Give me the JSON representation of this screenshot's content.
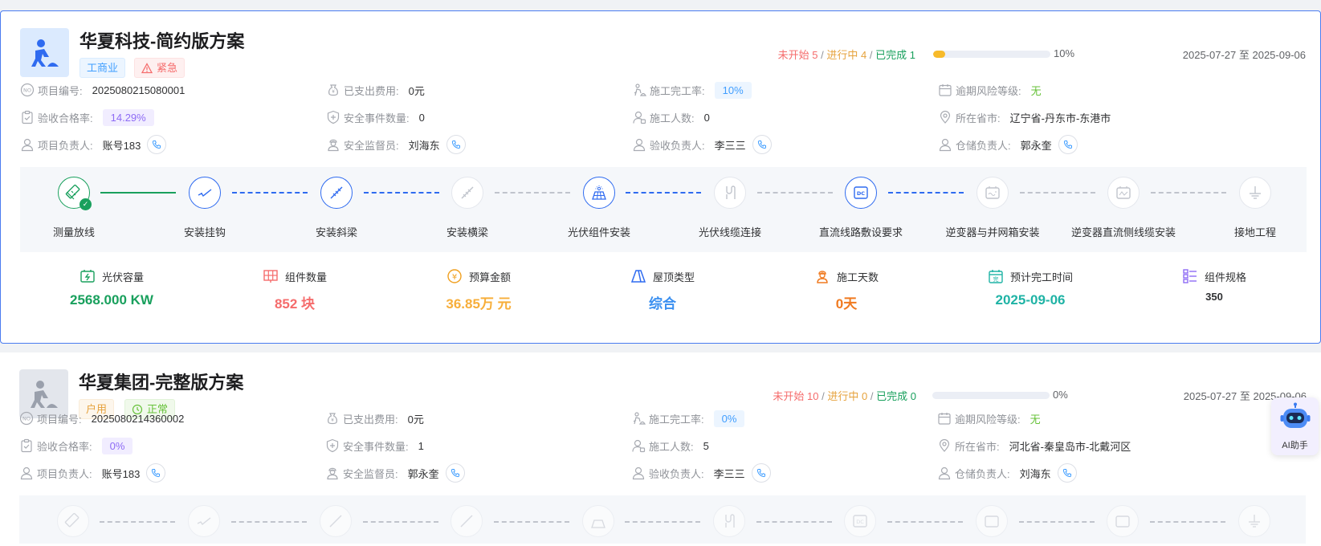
{
  "projects": [
    {
      "title": "华夏科技-简约版方案",
      "type_tag": "工商业",
      "status_tag": "紧急",
      "counts": {
        "not_started_label": "未开始",
        "not_started": "5",
        "in_progress_label": "进行中",
        "in_progress": "4",
        "done_label": "已完成",
        "done": "1",
        "sep": "/"
      },
      "progress_percent": 10,
      "progress_text": "10%",
      "date_range": "2025-07-27 至 2025-09-06",
      "fields": {
        "project_no_label": "项目编号:",
        "project_no": "2025080215080001",
        "spent_label": "已支出费用:",
        "spent": "0元",
        "completion_rate_label": "施工完工率:",
        "completion_rate": "10%",
        "overdue_risk_label": "逾期风险等级:",
        "overdue_risk": "无",
        "acceptance_rate_label": "验收合格率:",
        "acceptance_rate": "14.29%",
        "safety_events_label": "安全事件数量:",
        "safety_events": "0",
        "workers_label": "施工人数:",
        "workers": "0",
        "region_label": "所在省市:",
        "region": "辽宁省-丹东市-东港市",
        "manager_label": "项目负责人:",
        "manager": "账号183",
        "safety_officer_label": "安全监督员:",
        "safety_officer": "刘海东",
        "acceptance_officer_label": "验收负责人:",
        "acceptance_officer": "李三三",
        "storage_officer_label": "仓储负责人:",
        "storage_officer": "郭永奎"
      },
      "steps": [
        {
          "label": "测量放线",
          "state": "done",
          "icon": "measure-icon"
        },
        {
          "label": "安装挂钩",
          "state": "active",
          "icon": "hook-icon"
        },
        {
          "label": "安装斜梁",
          "state": "active",
          "icon": "slant-beam-icon"
        },
        {
          "label": "安装横梁",
          "state": "pending",
          "icon": "cross-beam-icon"
        },
        {
          "label": "光伏组件安装",
          "state": "active",
          "icon": "solar-panel-icon"
        },
        {
          "label": "光伏线缆连接",
          "state": "pending",
          "icon": "cable-icon"
        },
        {
          "label": "直流线路敷设要求",
          "state": "active",
          "icon": "dc-icon"
        },
        {
          "label": "逆变器与并网箱安装",
          "state": "pending",
          "icon": "inverter-icon"
        },
        {
          "label": "逆变器直流侧线缆安装",
          "state": "pending",
          "icon": "inverter-dc-icon"
        },
        {
          "label": "接地工程",
          "state": "pending",
          "icon": "ground-icon"
        }
      ],
      "metrics": {
        "capacity_label": "光伏容量",
        "capacity": "2568.000 KW",
        "modules_label": "组件数量",
        "modules": "852 块",
        "budget_label": "预算金额",
        "budget": "36.85万 元",
        "roof_label": "屋顶类型",
        "roof": "综合",
        "days_label": "施工天数",
        "days": "0天",
        "finish_label": "预计完工时间",
        "finish": "2025-09-06",
        "spec_label": "组件规格",
        "spec": "350"
      }
    },
    {
      "title": "华夏集团-完整版方案",
      "type_tag": "户用",
      "status_tag": "正常",
      "counts": {
        "not_started_label": "未开始",
        "not_started": "10",
        "in_progress_label": "进行中",
        "in_progress": "0",
        "done_label": "已完成",
        "done": "0",
        "sep": "/"
      },
      "progress_percent": 0,
      "progress_text": "0%",
      "date_range": "2025-07-27 至 2025-09-06",
      "fields": {
        "project_no_label": "项目编号:",
        "project_no": "2025080214360002",
        "spent_label": "已支出费用:",
        "spent": "0元",
        "completion_rate_label": "施工完工率:",
        "completion_rate": "0%",
        "overdue_risk_label": "逾期风险等级:",
        "overdue_risk": "无",
        "acceptance_rate_label": "验收合格率:",
        "acceptance_rate": "0%",
        "safety_events_label": "安全事件数量:",
        "safety_events": "1",
        "workers_label": "施工人数:",
        "workers": "5",
        "region_label": "所在省市:",
        "region": "河北省-秦皇岛市-北戴河区",
        "manager_label": "项目负责人:",
        "manager": "账号183",
        "safety_officer_label": "安全监督员:",
        "safety_officer": "郭永奎",
        "acceptance_officer_label": "验收负责人:",
        "acceptance_officer": "李三三",
        "storage_officer_label": "仓储负责人:",
        "storage_officer": "刘海东"
      }
    }
  ],
  "ai_assistant": {
    "label": "AI助手"
  },
  "colors": {
    "accent": "#2f6bf0",
    "done": "#19a05d",
    "warning": "#f7ba2a"
  }
}
